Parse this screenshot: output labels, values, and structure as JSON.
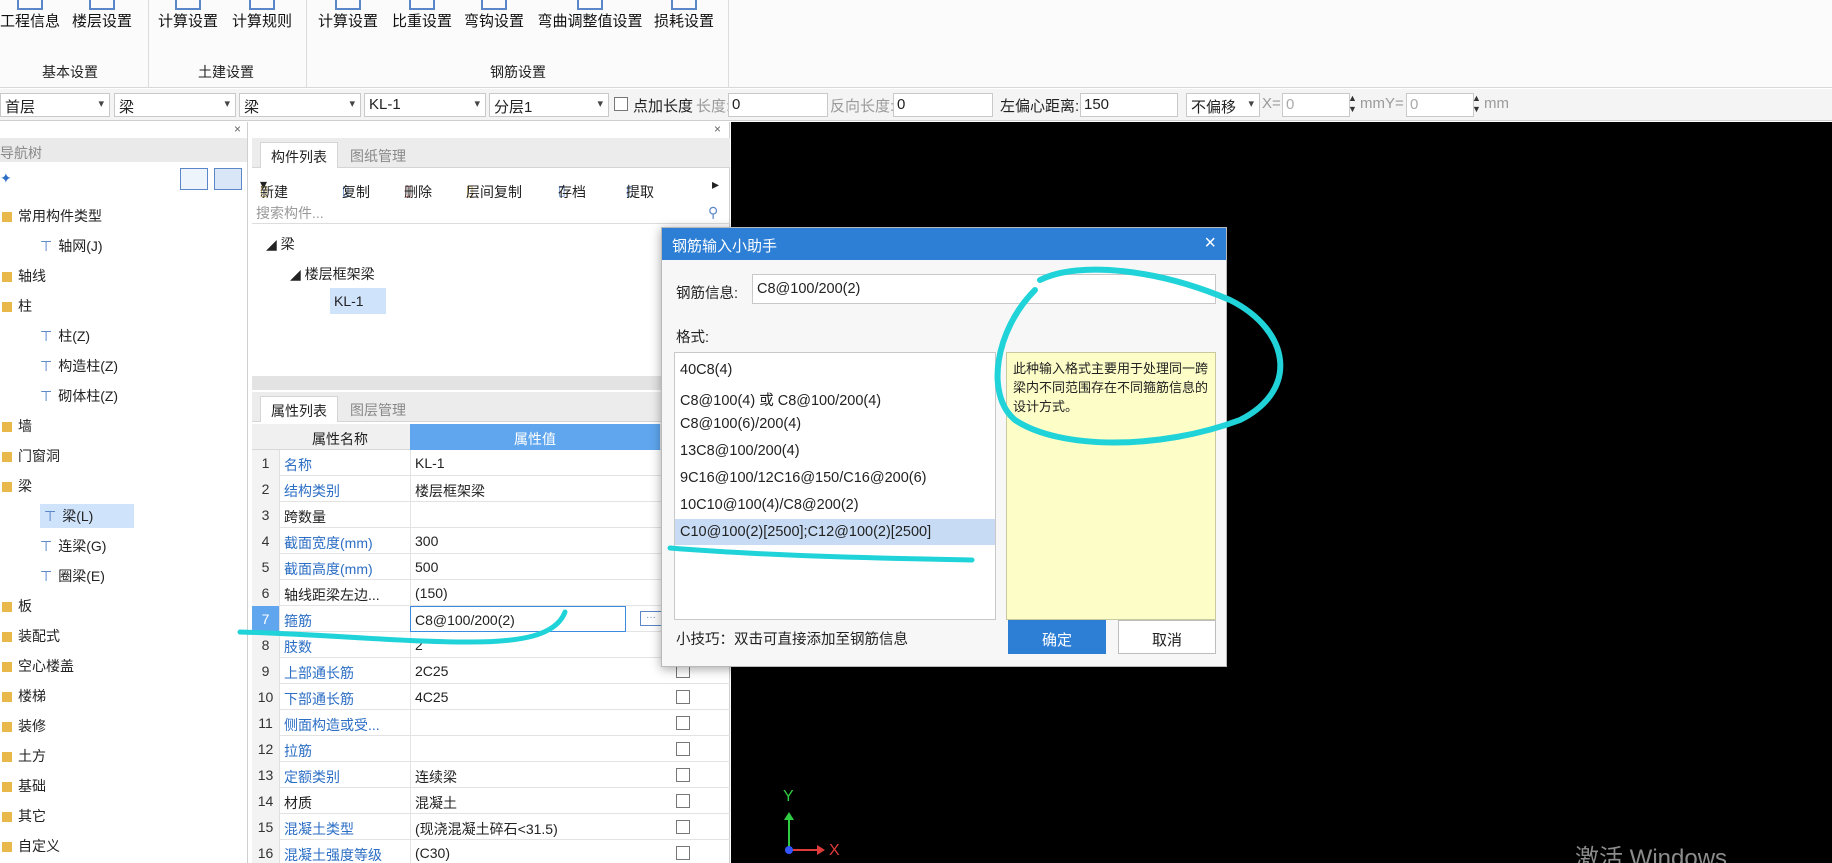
{
  "ribbon": {
    "buttons": [
      "工程信息",
      "楼层设置",
      "计算设置",
      "计算规则",
      "计算设置",
      "比重设置",
      "弯钩设置",
      "弯曲调整值设置",
      "损耗设置"
    ],
    "groups": [
      "基本设置",
      "土建设置",
      "钢筋设置"
    ]
  },
  "toolbar": {
    "floor": "首层",
    "category": "梁",
    "type": "梁",
    "component": "KL-1",
    "layer": "分层1",
    "add_length_label": "点加长度",
    "length_label": "长度:",
    "length_value": "0",
    "reverse_label": "反向长度:",
    "reverse_value": "0",
    "offset_label": "左偏心距离:",
    "offset_value": "150",
    "shift_mode": "不偏移",
    "x_label": "X=",
    "x_value": "0",
    "unit_mm_y": "mmY=",
    "y_value": "0",
    "unit_mm": "mm"
  },
  "nav": {
    "title": "导航树",
    "items": [
      {
        "label": "常用构件类型",
        "kind": "folder"
      },
      {
        "label": "轴网(J)",
        "kind": "child"
      },
      {
        "label": "轴线",
        "kind": "folder"
      },
      {
        "label": "柱",
        "kind": "folder"
      },
      {
        "label": "柱(Z)",
        "kind": "child"
      },
      {
        "label": "构造柱(Z)",
        "kind": "child"
      },
      {
        "label": "砌体柱(Z)",
        "kind": "child"
      },
      {
        "label": "墙",
        "kind": "folder"
      },
      {
        "label": "门窗洞",
        "kind": "folder"
      },
      {
        "label": "梁",
        "kind": "folder"
      },
      {
        "label": "梁(L)",
        "kind": "child-selected"
      },
      {
        "label": "连梁(G)",
        "kind": "child"
      },
      {
        "label": "圈梁(E)",
        "kind": "child"
      },
      {
        "label": "板",
        "kind": "folder"
      },
      {
        "label": "装配式",
        "kind": "folder"
      },
      {
        "label": "空心楼盖",
        "kind": "folder"
      },
      {
        "label": "楼梯",
        "kind": "folder"
      },
      {
        "label": "装修",
        "kind": "folder"
      },
      {
        "label": "土方",
        "kind": "folder"
      },
      {
        "label": "基础",
        "kind": "folder"
      },
      {
        "label": "其它",
        "kind": "folder"
      },
      {
        "label": "自定义",
        "kind": "folder"
      }
    ]
  },
  "components": {
    "tab_active": "构件列表",
    "tab_other": "图纸管理",
    "tools": [
      "新建",
      "复制",
      "删除",
      "层间复制",
      "存档",
      "提取"
    ],
    "search_placeholder": "搜索构件...",
    "tree": [
      "梁",
      "楼层框架梁",
      "KL-1"
    ]
  },
  "properties": {
    "tab_active": "属性列表",
    "tab_other": "图层管理",
    "col_name": "属性名称",
    "col_value": "属性值",
    "rows": [
      {
        "no": "1",
        "name": "名称",
        "value": "KL-1",
        "blue": true
      },
      {
        "no": "2",
        "name": "结构类别",
        "value": "楼层框架梁",
        "blue": true
      },
      {
        "no": "3",
        "name": "跨数量",
        "value": "",
        "blue": false
      },
      {
        "no": "4",
        "name": "截面宽度(mm)",
        "value": "300",
        "blue": true
      },
      {
        "no": "5",
        "name": "截面高度(mm)",
        "value": "500",
        "blue": true
      },
      {
        "no": "6",
        "name": "轴线距梁左边...",
        "value": "(150)",
        "blue": false
      },
      {
        "no": "7",
        "name": "箍筋",
        "value": "C8@100/200(2)",
        "blue": true
      },
      {
        "no": "8",
        "name": "肢数",
        "value": "2",
        "blue": true
      },
      {
        "no": "9",
        "name": "上部通长筋",
        "value": "2C25",
        "blue": true
      },
      {
        "no": "10",
        "name": "下部通长筋",
        "value": "4C25",
        "blue": true
      },
      {
        "no": "11",
        "name": "侧面构造或受...",
        "value": "",
        "blue": true
      },
      {
        "no": "12",
        "name": "拉筋",
        "value": "",
        "blue": true
      },
      {
        "no": "13",
        "name": "定额类别",
        "value": "连续梁",
        "blue": true
      },
      {
        "no": "14",
        "name": "材质",
        "value": "混凝土",
        "blue": false
      },
      {
        "no": "15",
        "name": "混凝土类型",
        "value": "(现浇混凝土碎石<31.5)",
        "blue": true
      },
      {
        "no": "16",
        "name": "混凝土强度等级",
        "value": "(C30)",
        "blue": true
      }
    ]
  },
  "dialog": {
    "title": "钢筋输入小助手",
    "info_label": "钢筋信息:",
    "info_value": "C8@100/200(2)",
    "format_label": "格式:",
    "formats": [
      "40C8(4)",
      "C8@100(4) 或 C8@100/200(4)",
      "C8@100(6)/200(4)",
      "13C8@100/200(4)",
      "9C16@100/12C16@150/C16@200(6)",
      "10C10@100(4)/C8@200(2)",
      "C10@100(2)[2500];C12@100(2)[2500]"
    ],
    "hint": "此种输入格式主要用于处理同一跨梁内不同范围存在不同箍筋信息的设计方式。",
    "tip": "小技巧：双击可直接添加至钢筋信息",
    "ok": "确定",
    "cancel": "取消"
  },
  "canvas": {
    "axis_x": "X",
    "axis_y": "Y",
    "watermark": "激活 Windows"
  },
  "colors": {
    "accent": "#2d7fd6",
    "annotation": "#1fd3d8"
  }
}
